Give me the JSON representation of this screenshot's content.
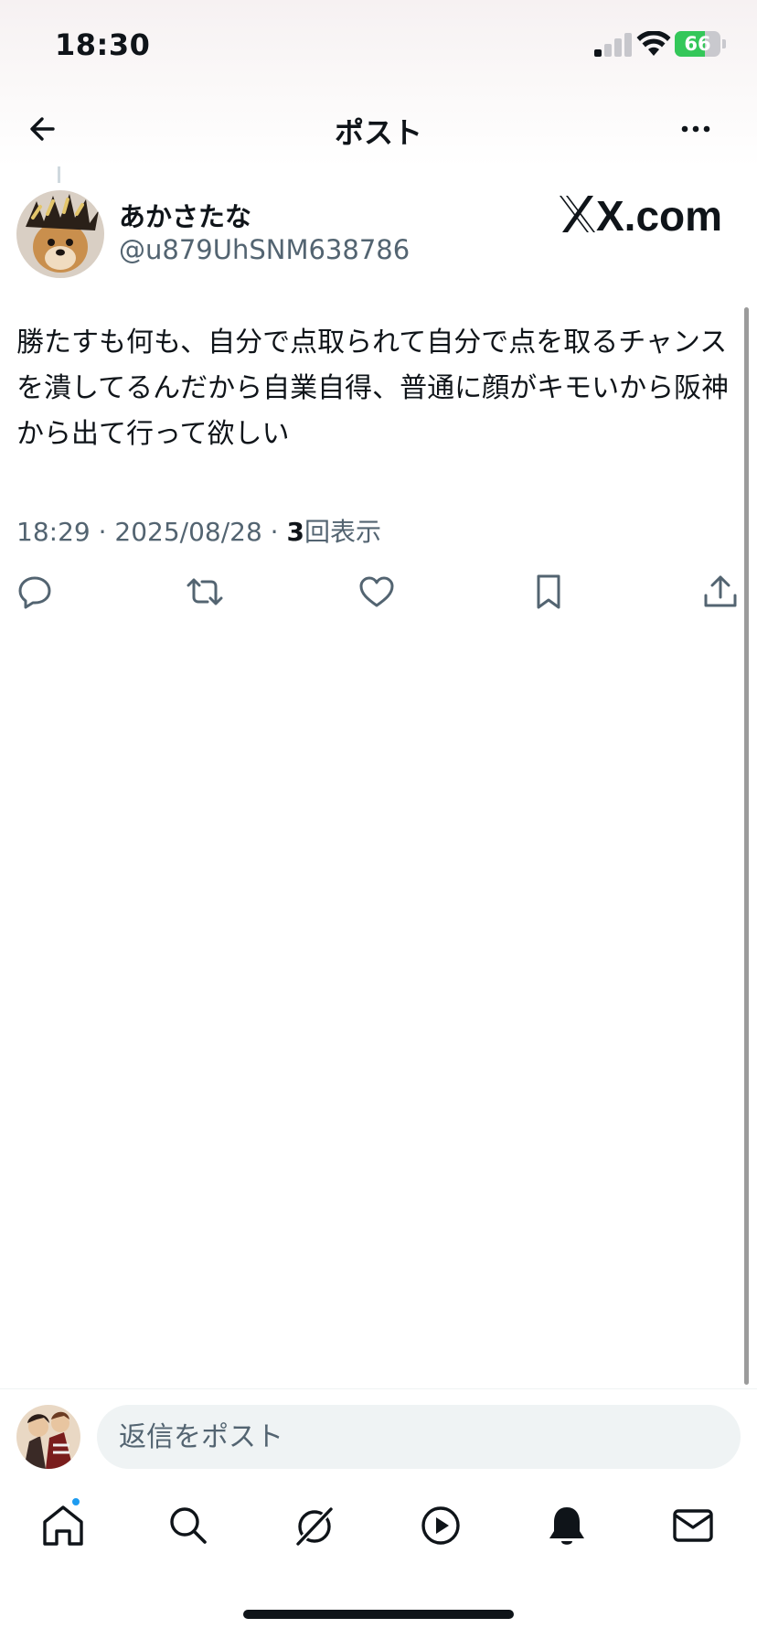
{
  "status_bar": {
    "time": "18:30",
    "battery_level": "66",
    "battery_fraction": 0.66,
    "signal_bars_filled": 1
  },
  "header": {
    "back_icon": "arrow-left-icon",
    "title": "ポスト",
    "more_icon": "more-horizontal-icon"
  },
  "post": {
    "author_name": "あかさたな",
    "author_handle": "@u879UhSNM638786",
    "watermark": "X.com",
    "text": "勝たすも何も、自分で点取られて自分で点を取るチャンスを潰してるんだから自業自得、普通に顔がキモいから阪神から出て行って欲しい",
    "timestamp": "18:29 · 2025/08/28 · ",
    "views_count": "3",
    "views_label": "回表示"
  },
  "actions": [
    {
      "name": "reply",
      "icon": "reply-icon"
    },
    {
      "name": "repost",
      "icon": "repost-icon"
    },
    {
      "name": "like",
      "icon": "heart-icon"
    },
    {
      "name": "bookmark",
      "icon": "bookmark-icon"
    },
    {
      "name": "share",
      "icon": "share-icon"
    }
  ],
  "reply_bar": {
    "placeholder": "返信をポスト"
  },
  "tabs": [
    {
      "name": "home",
      "icon": "home-icon",
      "has_badge": true
    },
    {
      "name": "search",
      "icon": "search-icon"
    },
    {
      "name": "grok",
      "icon": "grok-icon"
    },
    {
      "name": "video",
      "icon": "play-icon"
    },
    {
      "name": "notifications",
      "icon": "bell-icon"
    },
    {
      "name": "messages",
      "icon": "mail-icon"
    }
  ],
  "colors": {
    "text_primary": "#0f1419",
    "text_secondary": "#536471",
    "accent": "#1d9bf0",
    "battery_green": "#34c759",
    "input_bg": "#eff3f4"
  }
}
